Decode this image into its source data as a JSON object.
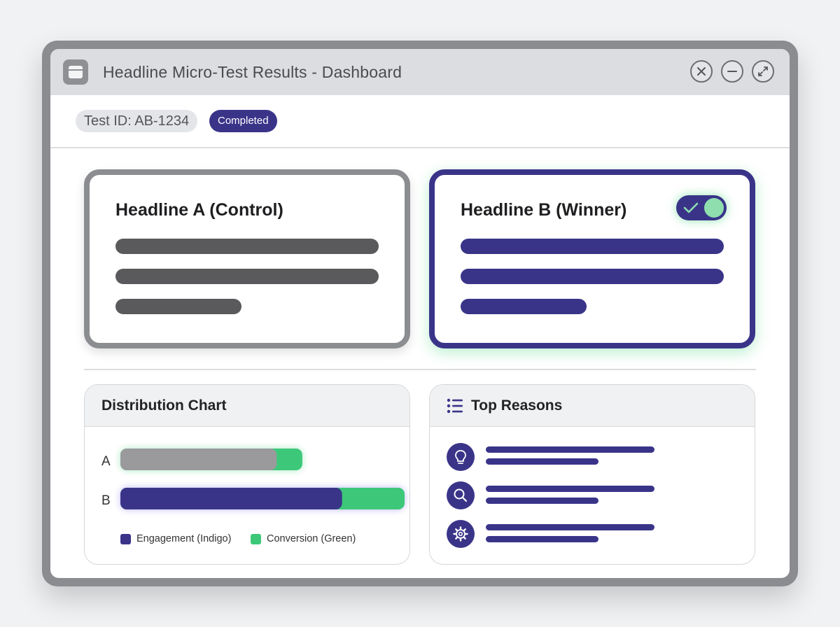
{
  "window": {
    "title": "Headline Micro-Test Results - Dashboard",
    "icons": [
      "app-window-icon",
      "close-icon",
      "minimize-icon",
      "maximize-icon"
    ]
  },
  "toolbar": {
    "test_id": "Test ID: AB-1234",
    "status": "Completed"
  },
  "cards": {
    "a": {
      "title": "Headline A (Control)",
      "color": "#8c8d91"
    },
    "b": {
      "title": "Headline B (Winner)",
      "color": "#3a3489",
      "toggle_on": true,
      "glow": "#3cd278"
    }
  },
  "distribution": {
    "title": "Distribution Chart",
    "legend": {
      "engagement": "Engagement (Indigo)",
      "conversion": "Conversion (Green)"
    },
    "colors": {
      "a_engagement": "#9a9a9d",
      "b_engagement": "#3a3489",
      "conversion": "#3cc878"
    }
  },
  "chart_data": {
    "type": "bar",
    "orientation": "horizontal",
    "stacked": true,
    "categories": [
      "A",
      "B"
    ],
    "series": [
      {
        "name": "Engagement (Indigo)",
        "values": [
          0.55,
          0.78
        ]
      },
      {
        "name": "Conversion (Green)",
        "values": [
          0.09,
          0.22
        ]
      }
    ],
    "xlim": [
      0,
      1
    ],
    "title": "Distribution Chart",
    "legend": "bottom"
  },
  "reasons": {
    "title": "Top Reasons",
    "items": [
      {
        "icon": "lightbulb-icon"
      },
      {
        "icon": "search-icon"
      },
      {
        "icon": "gear-icon"
      }
    ]
  }
}
